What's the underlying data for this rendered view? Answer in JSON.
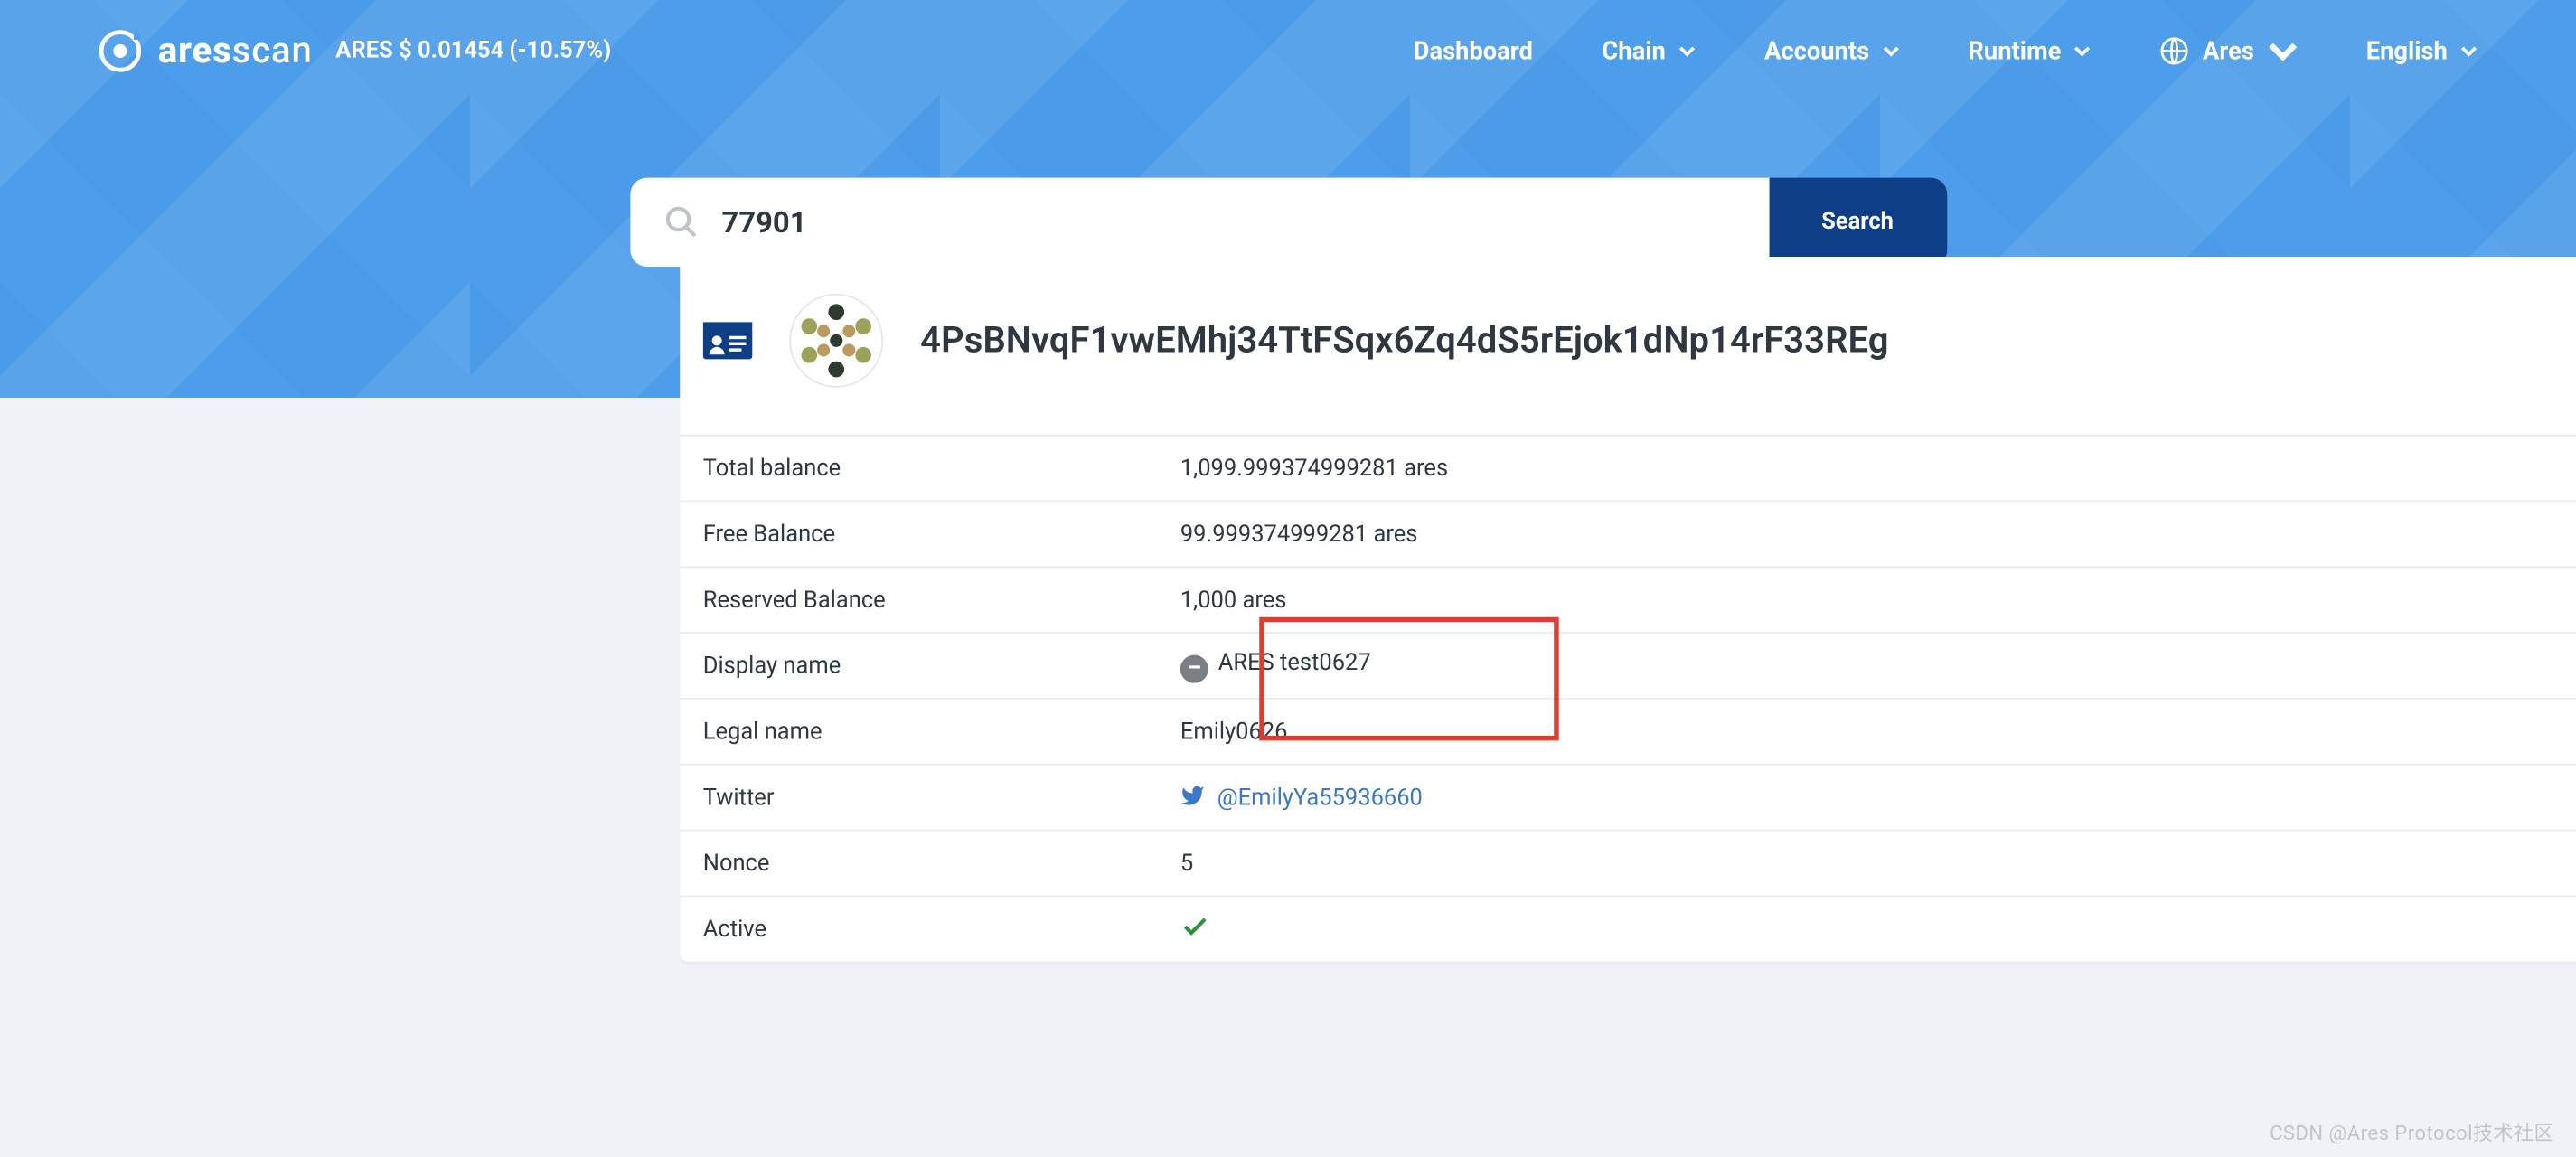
{
  "header": {
    "brand_primary": "ares",
    "brand_secondary": "scan",
    "ticker": "ARES $ 0.01454 (-10.57%)",
    "nav": {
      "dashboard": "Dashboard",
      "chain": "Chain",
      "accounts": "Accounts",
      "runtime": "Runtime"
    },
    "network": "Ares",
    "language": "English"
  },
  "search": {
    "value": "77901",
    "button": "Search"
  },
  "account": {
    "address": "4PsBNvqF1vwEMhj34TtFSqx6Zq4dS5rEjok1dNp14rF33REg",
    "rows": {
      "total_balance": {
        "label": "Total balance",
        "value": "1,099.999374999281 ares"
      },
      "free_balance": {
        "label": "Free Balance",
        "value": "99.999374999281 ares"
      },
      "reserved_balance": {
        "label": "Reserved Balance",
        "value": "1,000 ares"
      },
      "display_name": {
        "label": "Display name",
        "value": "ARES test0627"
      },
      "legal_name": {
        "label": "Legal name",
        "value": "Emily0626"
      },
      "twitter": {
        "label": "Twitter",
        "value": "@EmilyYa55936660"
      },
      "nonce": {
        "label": "Nonce",
        "value": "5"
      },
      "active": {
        "label": "Active",
        "value": "true"
      }
    }
  },
  "watermark": "CSDN @Ares Protocol技术社区"
}
